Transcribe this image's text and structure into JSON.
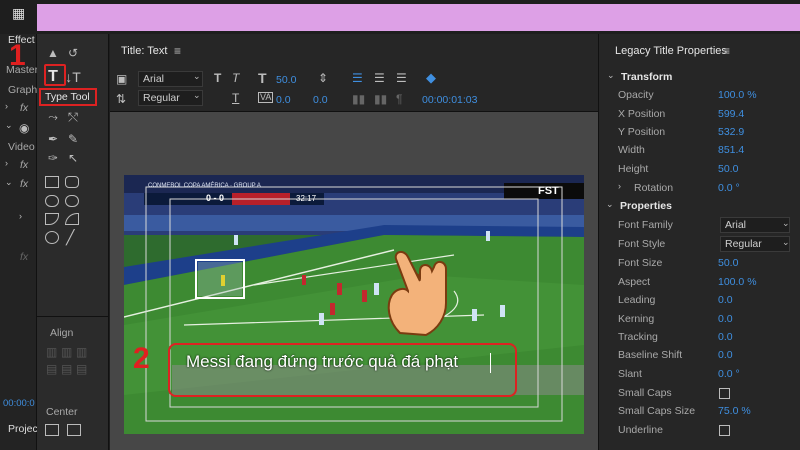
{
  "left_panel": {
    "effect_tab": "Effect",
    "master_label": "Master",
    "graphic_label": "Graph",
    "video_label": "Video",
    "fx_label": "fx",
    "timecode": "00:00:0",
    "project_tab": "Projec"
  },
  "tools": {
    "type_tool_tooltip": "Type Tool",
    "align_label": "Align",
    "center_label": "Center"
  },
  "title_panel": {
    "title": "Title: Text",
    "font_family": "Arial",
    "font_style": "Regular",
    "font_size": "50.0",
    "kerning": "0.0",
    "leading": "0.0",
    "timecode": "00:00:01:03"
  },
  "scoreboard": {
    "competition": "CONMEBOL COPA AMÉRICA · GROUP A",
    "score": "0 - 0",
    "clock": "32:17",
    "broadcaster": "FST"
  },
  "caption_text": "Messi đang đứng trước quả đá phạt",
  "step_labels": {
    "step1": "1",
    "step2": "2"
  },
  "properties_panel": {
    "title": "Legacy Title Properties",
    "transform_header": "Transform",
    "opacity_label": "Opacity",
    "opacity_value": "100.0 %",
    "x_label": "X Position",
    "x_value": "599.4",
    "y_label": "Y Position",
    "y_value": "532.9",
    "width_label": "Width",
    "width_value": "851.4",
    "height_label": "Height",
    "height_value": "50.0",
    "rotation_label": "Rotation",
    "rotation_value": "0.0 °",
    "properties_header": "Properties",
    "font_family_label": "Font Family",
    "font_family_value": "Arial",
    "font_style_label": "Font Style",
    "font_style_value": "Regular",
    "font_size_label": "Font Size",
    "font_size_value": "50.0",
    "aspect_label": "Aspect",
    "aspect_value": "100.0 %",
    "leading_label": "Leading",
    "leading_value": "0.0",
    "kerning_label": "Kerning",
    "kerning_value": "0.0",
    "tracking_label": "Tracking",
    "tracking_value": "0.0",
    "baseline_label": "Baseline Shift",
    "baseline_value": "0.0",
    "slant_label": "Slant",
    "slant_value": "0.0 °",
    "small_caps_label": "Small Caps",
    "small_caps_size_label": "Small Caps Size",
    "small_caps_size_value": "75.0 %",
    "underline_label": "Underline"
  },
  "colors": {
    "accent_blue": "#3f8fe0",
    "annotation_red": "#e02020",
    "banner": "#dda0e6"
  }
}
